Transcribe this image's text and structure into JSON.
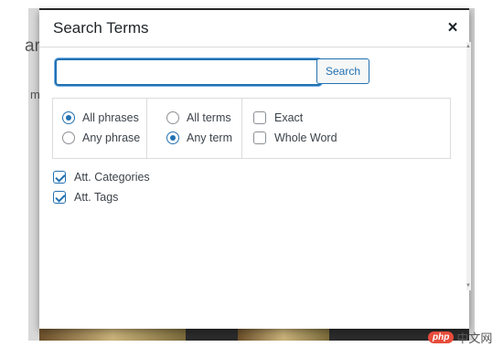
{
  "background": {
    "fragment_left_top": "ar",
    "fragment_left_mid": "m"
  },
  "modal": {
    "title": "Search Terms",
    "close_glyph": "×",
    "search": {
      "value": "",
      "placeholder": "",
      "button_label": "Search"
    },
    "match_options": [
      {
        "label": "All phrases",
        "checked": true
      },
      {
        "label": "Any phrase",
        "checked": false
      }
    ],
    "term_options": [
      {
        "label": "All terms",
        "checked": false
      },
      {
        "label": "Any term",
        "checked": true
      }
    ],
    "word_options": [
      {
        "label": "Exact",
        "checked": false
      },
      {
        "label": "Whole Word",
        "checked": false
      }
    ],
    "taxonomies": [
      {
        "label": "Att. Categories",
        "checked": true
      },
      {
        "label": "Att. Tags",
        "checked": true
      }
    ]
  },
  "watermark": {
    "badge": "php",
    "text": "中文网"
  },
  "colors": {
    "accent": "#2271b1",
    "overlay": "#2b2b2b",
    "border": "#dcdcde"
  },
  "icons": {
    "close": "close-icon",
    "check": "check-icon"
  }
}
